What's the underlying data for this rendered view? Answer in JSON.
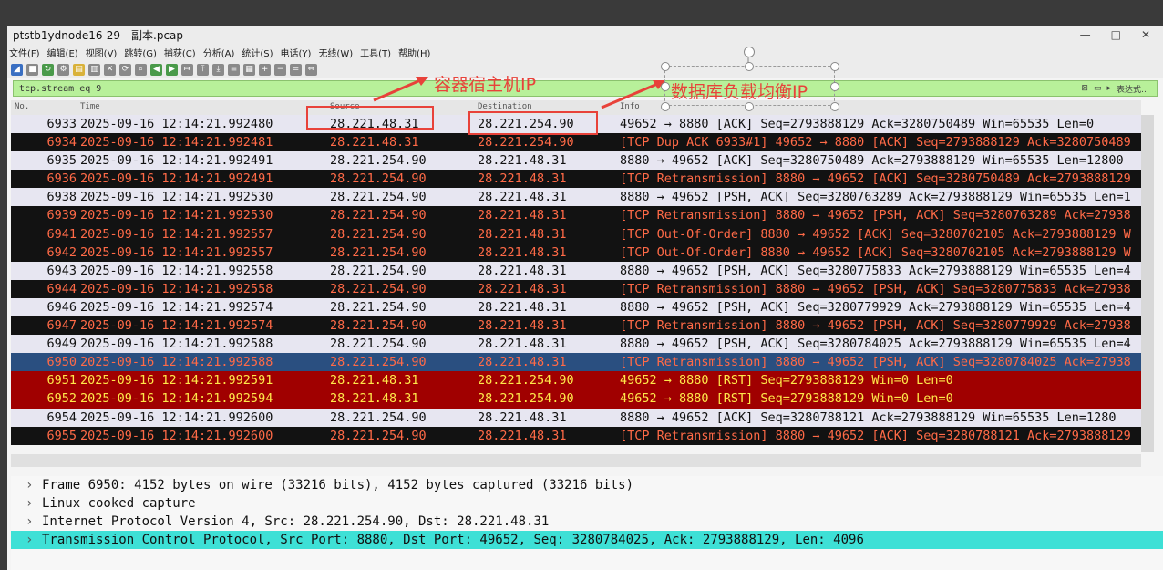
{
  "window": {
    "title": "ptstb1ydnode16-29 - 副本.pcap",
    "controls": [
      "—",
      "□",
      "✕"
    ]
  },
  "menu": [
    "文件(F)",
    "编辑(E)",
    "视图(V)",
    "跳转(G)",
    "捕获(C)",
    "分析(A)",
    "统计(S)",
    "电话(Y)",
    "无线(W)",
    "工具(T)",
    "帮助(H)"
  ],
  "filter": {
    "value": "tcp.stream eq 9",
    "expression_label": "表达式…"
  },
  "columns": {
    "no": "No.",
    "time": "Time",
    "source": "Source",
    "destination": "Destination",
    "info": "Info"
  },
  "packets": [
    {
      "no": "6933",
      "time": "2025-09-16 12:14:21.992480",
      "src": "28.221.48.31",
      "dst": "28.221.254.90",
      "info": "49652 → 8880 [ACK] Seq=2793888129 Ack=3280750489 Win=65535 Len=0",
      "style": "white"
    },
    {
      "no": "6934",
      "time": "2025-09-16 12:14:21.992481",
      "src": "28.221.48.31",
      "dst": "28.221.254.90",
      "info": "[TCP Dup ACK 6933#1] 49652 → 8880 [ACK] Seq=2793888129 Ack=3280750489",
      "style": "dark"
    },
    {
      "no": "6935",
      "time": "2025-09-16 12:14:21.992491",
      "src": "28.221.254.90",
      "dst": "28.221.48.31",
      "info": "8880 → 49652 [ACK] Seq=3280750489 Ack=2793888129 Win=65535 Len=12800",
      "style": "white"
    },
    {
      "no": "6936",
      "time": "2025-09-16 12:14:21.992491",
      "src": "28.221.254.90",
      "dst": "28.221.48.31",
      "info": "[TCP Retransmission] 8880 → 49652 [ACK] Seq=3280750489 Ack=2793888129",
      "style": "dark"
    },
    {
      "no": "6938",
      "time": "2025-09-16 12:14:21.992530",
      "src": "28.221.254.90",
      "dst": "28.221.48.31",
      "info": "8880 → 49652 [PSH, ACK] Seq=3280763289 Ack=2793888129 Win=65535 Len=1",
      "style": "white"
    },
    {
      "no": "6939",
      "time": "2025-09-16 12:14:21.992530",
      "src": "28.221.254.90",
      "dst": "28.221.48.31",
      "info": "[TCP Retransmission] 8880 → 49652 [PSH, ACK] Seq=3280763289 Ack=27938",
      "style": "dark"
    },
    {
      "no": "6941",
      "time": "2025-09-16 12:14:21.992557",
      "src": "28.221.254.90",
      "dst": "28.221.48.31",
      "info": "[TCP Out-Of-Order] 8880 → 49652 [ACK] Seq=3280702105 Ack=2793888129 W",
      "style": "dark"
    },
    {
      "no": "6942",
      "time": "2025-09-16 12:14:21.992557",
      "src": "28.221.254.90",
      "dst": "28.221.48.31",
      "info": "[TCP Out-Of-Order] 8880 → 49652 [ACK] Seq=3280702105 Ack=2793888129 W",
      "style": "dark"
    },
    {
      "no": "6943",
      "time": "2025-09-16 12:14:21.992558",
      "src": "28.221.254.90",
      "dst": "28.221.48.31",
      "info": "8880 → 49652 [PSH, ACK] Seq=3280775833 Ack=2793888129 Win=65535 Len=4",
      "style": "white"
    },
    {
      "no": "6944",
      "time": "2025-09-16 12:14:21.992558",
      "src": "28.221.254.90",
      "dst": "28.221.48.31",
      "info": "[TCP Retransmission] 8880 → 49652 [PSH, ACK] Seq=3280775833 Ack=27938",
      "style": "dark"
    },
    {
      "no": "6946",
      "time": "2025-09-16 12:14:21.992574",
      "src": "28.221.254.90",
      "dst": "28.221.48.31",
      "info": "8880 → 49652 [PSH, ACK] Seq=3280779929 Ack=2793888129 Win=65535 Len=4",
      "style": "white"
    },
    {
      "no": "6947",
      "time": "2025-09-16 12:14:21.992574",
      "src": "28.221.254.90",
      "dst": "28.221.48.31",
      "info": "[TCP Retransmission] 8880 → 49652 [PSH, ACK] Seq=3280779929 Ack=27938",
      "style": "dark"
    },
    {
      "no": "6949",
      "time": "2025-09-16 12:14:21.992588",
      "src": "28.221.254.90",
      "dst": "28.221.48.31",
      "info": "8880 → 49652 [PSH, ACK] Seq=3280784025 Ack=2793888129 Win=65535 Len=4",
      "style": "white"
    },
    {
      "no": "6950",
      "time": "2025-09-16 12:14:21.992588",
      "src": "28.221.254.90",
      "dst": "28.221.48.31",
      "info": "[TCP Retransmission] 8880 → 49652 [PSH, ACK] Seq=3280784025 Ack=27938",
      "style": "sel"
    },
    {
      "no": "6951",
      "time": "2025-09-16 12:14:21.992591",
      "src": "28.221.48.31",
      "dst": "28.221.254.90",
      "info": "49652 → 8880 [RST] Seq=2793888129 Win=0 Len=0",
      "style": "red"
    },
    {
      "no": "6952",
      "time": "2025-09-16 12:14:21.992594",
      "src": "28.221.48.31",
      "dst": "28.221.254.90",
      "info": "49652 → 8880 [RST] Seq=2793888129 Win=0 Len=0",
      "style": "red"
    },
    {
      "no": "6954",
      "time": "2025-09-16 12:14:21.992600",
      "src": "28.221.254.90",
      "dst": "28.221.48.31",
      "info": "8880 → 49652 [ACK] Seq=3280788121 Ack=2793888129 Win=65535 Len=1280",
      "style": "white"
    },
    {
      "no": "6955",
      "time": "2025-09-16 12:14:21.992600",
      "src": "28.221.254.90",
      "dst": "28.221.48.31",
      "info": "[TCP Retransmission] 8880 → 49652 [ACK] Seq=3280788121 Ack=2793888129",
      "style": "dark"
    }
  ],
  "details": [
    "Frame 6950: 4152 bytes on wire (33216 bits), 4152 bytes captured (33216 bits)",
    "Linux cooked capture",
    "Internet Protocol Version 4, Src: 28.221.254.90, Dst: 28.221.48.31",
    "Transmission Control Protocol, Src Port: 8880, Dst Port: 49652, Seq: 3280784025, Ack: 2793888129, Len: 4096"
  ],
  "annotations": {
    "container_host_ip": "容器宿主机IP",
    "db_lb_ip": "数据库负载均衡IP"
  },
  "colors": {
    "red_row": "#a00000",
    "dark_row": "#121212",
    "white_row": "#e7e6f1",
    "selected_row": "#2a4f80",
    "annot_red": "#e8423a"
  }
}
